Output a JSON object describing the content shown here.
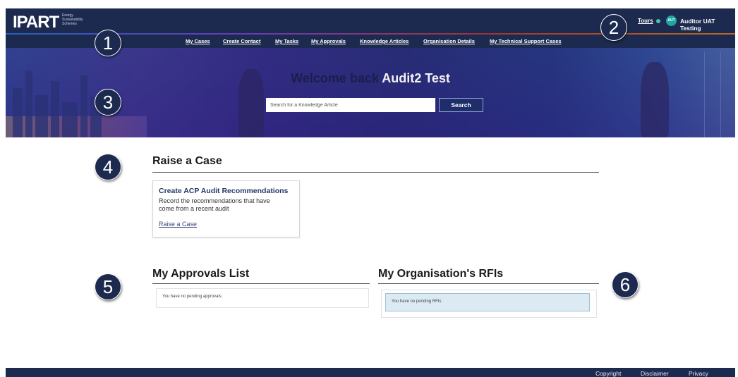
{
  "header": {
    "logo": "IPART",
    "logo_sub": "Energy Sustainability Schemes",
    "tours_label": "Tours",
    "user_initials": "AUT",
    "user_name": "Auditor UAT Testing"
  },
  "nav": {
    "items": [
      "My Cases",
      "Create Contact",
      "My Tasks",
      "My Approvals",
      "Knowledge Articles",
      "Organisation Details",
      "My Technical Support Cases"
    ]
  },
  "hero": {
    "welcome_prefix": "Welcome back",
    "welcome_name": "Audit2 Test",
    "search_placeholder": "Search for a Knowledge Article",
    "search_button": "Search"
  },
  "markers": [
    "1",
    "2",
    "3",
    "4",
    "5",
    "6"
  ],
  "raise_case": {
    "title": "Raise a Case",
    "card_title": "Create ACP Audit Recommendations",
    "card_desc": "Record the recommendations that have come from a recent audit",
    "card_link": "Raise a Case"
  },
  "approvals": {
    "title": "My Approvals List",
    "empty": "You have no pending approvals"
  },
  "rfis": {
    "title": "My Organisation's RFIs",
    "empty": "You have no pending RFIs"
  },
  "footer": {
    "links": [
      "Copyright",
      "Disclaimer",
      "Privacy"
    ]
  },
  "colors": {
    "navy": "#1d2a4f",
    "rfi_box": "#dbeaf3",
    "teal": "#1fa6a0"
  }
}
